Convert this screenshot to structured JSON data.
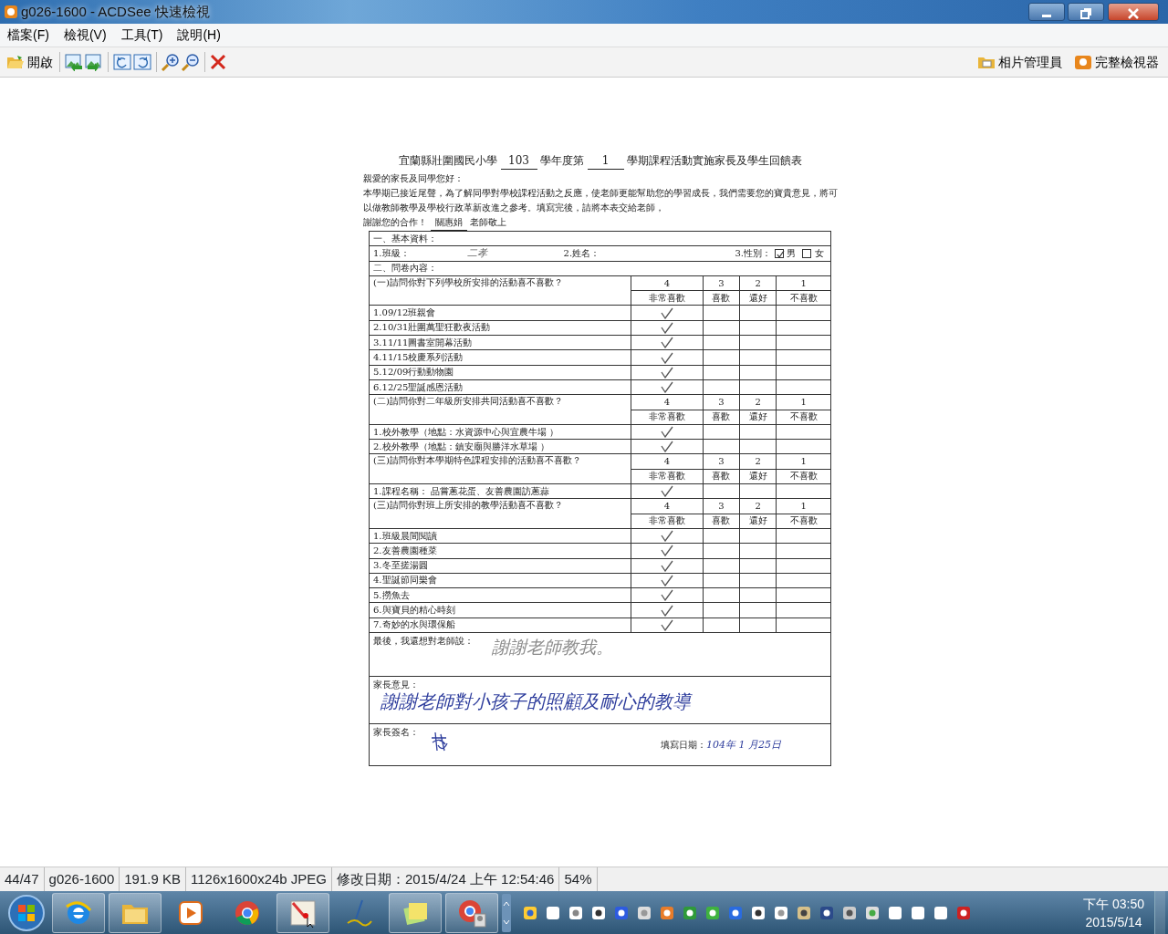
{
  "window": {
    "title": "g026-1600 - ACDSee 快速檢視"
  },
  "menu": [
    "檔案(F)",
    "檢視(V)",
    "工具(T)",
    "說明(H)"
  ],
  "toolbar": {
    "open": "開啟",
    "right": [
      "相片管理員",
      "完整檢視器"
    ]
  },
  "document": {
    "title": [
      {
        "text": "宜蘭縣壯圍國民小學",
        "blank": false
      },
      {
        "text": "103",
        "blank": true
      },
      {
        "text": "學年度第",
        "blank": false
      },
      {
        "text": "1",
        "blank": true
      },
      {
        "text": "學期課程活動實施家長及學生回饋表",
        "blank": false
      }
    ],
    "greeting": "親愛的家長及同學您好：",
    "intro": "本學期已接近尾聲，為了解同學對學校課程活動之反應，使老師更能幫助您的學習成長，我們需要您的寶貴意見，將可以做教師教學及學校行政革新改進之參考。填寫完後，請將本表交給老師，",
    "closing": [
      {
        "text": "謝謝您的合作！",
        "blank": false
      },
      {
        "text": "關惠娟",
        "blank": true
      },
      {
        "text": "老師敬上",
        "blank": false
      }
    ],
    "basic": {
      "heading": "一、基本資料：",
      "class_label": "1.班級：",
      "class_value": "二孝",
      "name_label": "2.姓名：",
      "gender_label": "3.性別：",
      "genders": [
        {
          "label": "男",
          "checked": true
        },
        {
          "label": "女",
          "checked": false
        }
      ]
    },
    "survey_heading": "二、問卷內容：",
    "groups": [
      {
        "question": "(一)請問你對下列學校所安排的活動喜不喜歡？",
        "scale": [
          {
            "score": "4",
            "label": "非常喜歡"
          },
          {
            "score": "3",
            "label": "喜歡"
          },
          {
            "score": "2",
            "label": "還好"
          },
          {
            "score": "1",
            "label": "不喜歡"
          }
        ],
        "items": [
          {
            "label": "1.09/12班親會",
            "checks": [
              true,
              false,
              false,
              false
            ]
          },
          {
            "label": "2.10/31壯圍萬聖狂歡夜活動",
            "checks": [
              true,
              false,
              false,
              false
            ]
          },
          {
            "label": "3.11/11圖書室開幕活動",
            "checks": [
              true,
              false,
              false,
              false
            ]
          },
          {
            "label": "4.11/15校慶系列活動",
            "checks": [
              true,
              false,
              false,
              false
            ]
          },
          {
            "label": "5.12/09行動動物園",
            "checks": [
              true,
              false,
              false,
              false
            ]
          },
          {
            "label": "6.12/25聖誕感恩活動",
            "checks": [
              true,
              false,
              false,
              false
            ]
          }
        ]
      },
      {
        "question": "(二)請問你對二年級所安排共同活動喜不喜歡？",
        "scale": [
          {
            "score": "4",
            "label": "非常喜歡"
          },
          {
            "score": "3",
            "label": "喜歡"
          },
          {
            "score": "2",
            "label": "還好"
          },
          {
            "score": "1",
            "label": "不喜歡"
          }
        ],
        "items": [
          {
            "label": "1.校外教學（地點：水資源中心與宜農牛場 ）",
            "checks": [
              true,
              false,
              false,
              false
            ]
          },
          {
            "label": "2.校外教學（地點：鎮安廟與勝洋水草場 ）",
            "checks": [
              true,
              false,
              false,
              false
            ]
          }
        ]
      },
      {
        "question": "(三)請問你對本學期特色課程安排的活動喜不喜歡？",
        "scale": [
          {
            "score": "4",
            "label": "非常喜歡"
          },
          {
            "score": "3",
            "label": "喜歡"
          },
          {
            "score": "2",
            "label": "還好"
          },
          {
            "score": "1",
            "label": "不喜歡"
          }
        ],
        "items": [
          {
            "label": "1.課程名稱： 品嘗蔥花蛋、友善農園訪蔥蒜",
            "checks": [
              true,
              false,
              false,
              false
            ]
          }
        ]
      },
      {
        "question": "(三)請問你對班上所安排的教學活動喜不喜歡？",
        "scale": [
          {
            "score": "4",
            "label": "非常喜歡"
          },
          {
            "score": "3",
            "label": "喜歡"
          },
          {
            "score": "2",
            "label": "還好"
          },
          {
            "score": "1",
            "label": "不喜歡"
          }
        ],
        "items": [
          {
            "label": "1.班級晨間閱讀",
            "checks": [
              true,
              false,
              false,
              false
            ]
          },
          {
            "label": "2.友善農園種菜",
            "checks": [
              true,
              false,
              false,
              false
            ]
          },
          {
            "label": "3.冬至搓湯圓",
            "checks": [
              true,
              false,
              false,
              false
            ]
          },
          {
            "label": "4.聖誕節同樂會",
            "checks": [
              true,
              false,
              false,
              false
            ]
          },
          {
            "label": "5.撈魚去",
            "checks": [
              true,
              false,
              false,
              false
            ]
          },
          {
            "label": "6.與寶貝的精心時刻",
            "checks": [
              true,
              false,
              false,
              false
            ]
          },
          {
            "label": "7.奇妙的水與環保船",
            "checks": [
              true,
              false,
              false,
              false
            ]
          }
        ]
      }
    ],
    "comments": [
      {
        "label": "最後，我還想對老師說：",
        "handwriting": "謝謝老師教我。",
        "color": "#8a8a8a"
      },
      {
        "label": "家長意見：",
        "handwriting": "謝謝老師對小孩子的照顧及耐心的教導",
        "color": "#2d3c9c"
      }
    ],
    "signature": {
      "label": "家長簽名：",
      "date_label": "填寫日期：",
      "date": "104年 1 月25日"
    }
  },
  "status_bar": [
    "44/47",
    "g026-1600",
    "191.9 KB",
    "1126x1600x24b JPEG",
    "修改日期：2015/4/24 上午 12:54:46",
    "54%"
  ],
  "taskbar": {
    "time": "下午 03:50",
    "date": "2015/5/14"
  }
}
